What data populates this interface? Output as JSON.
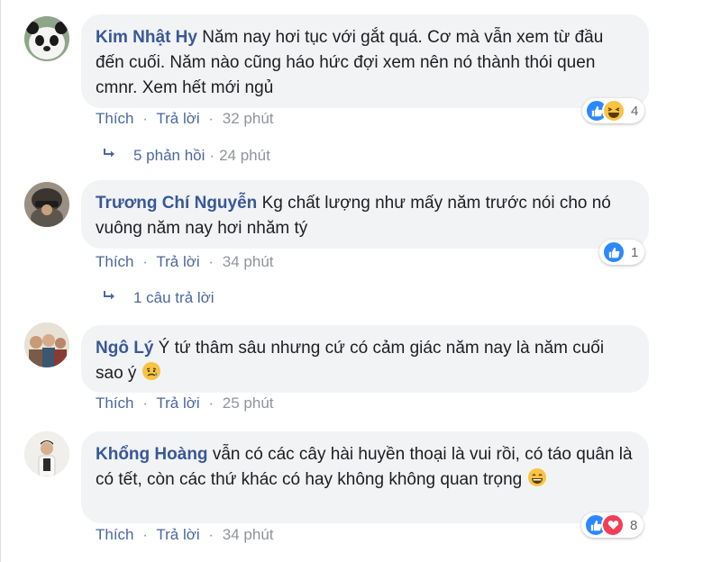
{
  "comments": [
    {
      "author": "Kim Nhật Hy",
      "text": "Năm nay hơi tục với gắt quá. Cơ mà vẫn xem từ đầu đến cuối. Năm nào cũng háo hức đợi xem nên nó thành thói quen cmnr. Xem hết mới ngủ",
      "like_label": "Thích",
      "reply_label": "Trả lời",
      "time": "32 phút",
      "reaction_count": "4",
      "reactions": [
        "like-icon",
        "haha-icon"
      ],
      "replies_label": "5 phản hồi",
      "replies_time": "24 phút",
      "avatar": "panda-avatar"
    },
    {
      "author": "Trương Chí Nguyễn",
      "text": "Kg chất lượng như mấy năm trước nói cho nó vuông năm nay hơi nhăm tý",
      "like_label": "Thích",
      "reply_label": "Trả lời",
      "time": "34 phút",
      "reaction_count": "1",
      "reactions": [
        "like-icon"
      ],
      "replies_label": "1 câu trả lời",
      "avatar": "helmet-avatar"
    },
    {
      "author": "Ngô Lý",
      "text": "Ý tứ thâm sâu nhưng cứ có cảm giác năm nay là năm cuối sao ý",
      "like_label": "Thích",
      "reply_label": "Trả lời",
      "time": "25 phút",
      "avatar": "group-avatar"
    },
    {
      "author": "Khổng Hoàng",
      "text": "vẫn có các cây hài huyền thoại là vui rồi, có táo quân là có tết, còn các thứ khác có hay không không quan trọng",
      "like_label": "Thích",
      "reply_label": "Trả lời",
      "time": "34 phút",
      "reaction_count": "8",
      "reactions": [
        "like-icon",
        "love-icon"
      ],
      "avatar": "person-avatar"
    }
  ],
  "separator": "·",
  "colors": {
    "author": "#385898",
    "link": "#4b67a1",
    "muted": "#90949c",
    "bubble": "#f2f3f5",
    "like": "#2d88ff",
    "haha": "#f7c443",
    "love": "#f33e58"
  }
}
